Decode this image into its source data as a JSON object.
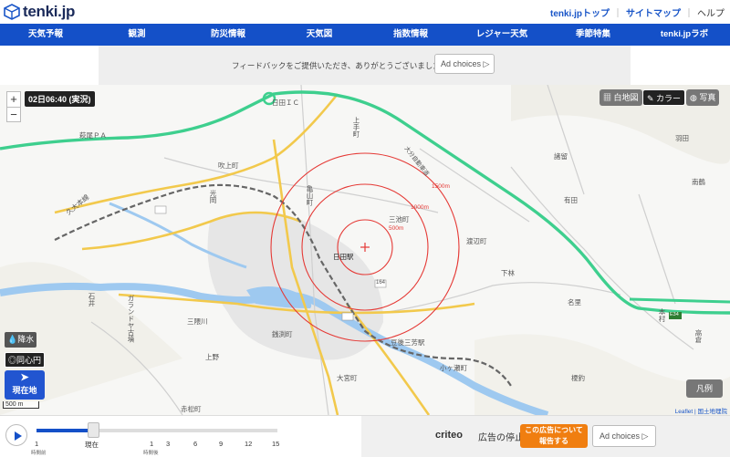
{
  "header": {
    "logo_text": "tenki.jp",
    "links": [
      "tenki.jpトップ",
      "サイトマップ",
      "ヘルプ"
    ],
    "separator": "｜"
  },
  "nav": {
    "items": [
      "天気予報",
      "観測",
      "防災情報",
      "天気図",
      "指数情報",
      "レジャー天気",
      "季節特集",
      "tenki.jpラボ"
    ]
  },
  "ad_top": {
    "text": "フィードバックをご提供いただき、ありがとうございました。",
    "adchoices": "Ad choices ▷"
  },
  "map": {
    "time_label": "02日06:40 (実況)",
    "zoom_in": "+",
    "zoom_out": "−",
    "btn_white": "白地図",
    "btn_color": "カラー",
    "btn_photo": "写真",
    "ctrl_rain": "降水",
    "ctrl_circle": "同心円",
    "locate_label": "現在地",
    "scale_label": "500 m",
    "legend_label": "凡例",
    "attribution": "Leaflet | 国土地理院",
    "ring_labels": [
      "500m",
      "1000m",
      "1500m"
    ],
    "place_labels": [
      "日田ＩＣ",
      "萩尾ＰＡ",
      "吹上町",
      "上手町",
      "羽田",
      "諸留",
      "南鶴",
      "光岡",
      "有田",
      "亀山町",
      "三池町",
      "日田駅",
      "渡辺町",
      "下林",
      "名里",
      "本村",
      "高倉",
      "石井",
      "銭渕町",
      "三隈川",
      "豆後三芳駅",
      "小ヶ瀬町",
      "上野",
      "大宮町",
      "榎釣",
      "赤松町",
      "久大本線",
      "大分自動車道",
      "ガランドヤ古墳",
      "E34",
      "164"
    ],
    "colors": {
      "expressway": "#3ecf8e",
      "rings": "#e53935",
      "road_major": "#f2c94c",
      "river": "#9ec9f0"
    }
  },
  "timeline": {
    "ticks": [
      "1",
      "現在",
      "1",
      "3",
      "6",
      "9",
      "12",
      "15"
    ],
    "sub_labels": [
      "時間前",
      "時間後"
    ]
  },
  "ad_bottom": {
    "brand": "criteo",
    "stop_label": "広告の停止",
    "report_label_1": "この広告について",
    "report_label_2": "報告する",
    "adchoices": "Ad choices ▷"
  }
}
